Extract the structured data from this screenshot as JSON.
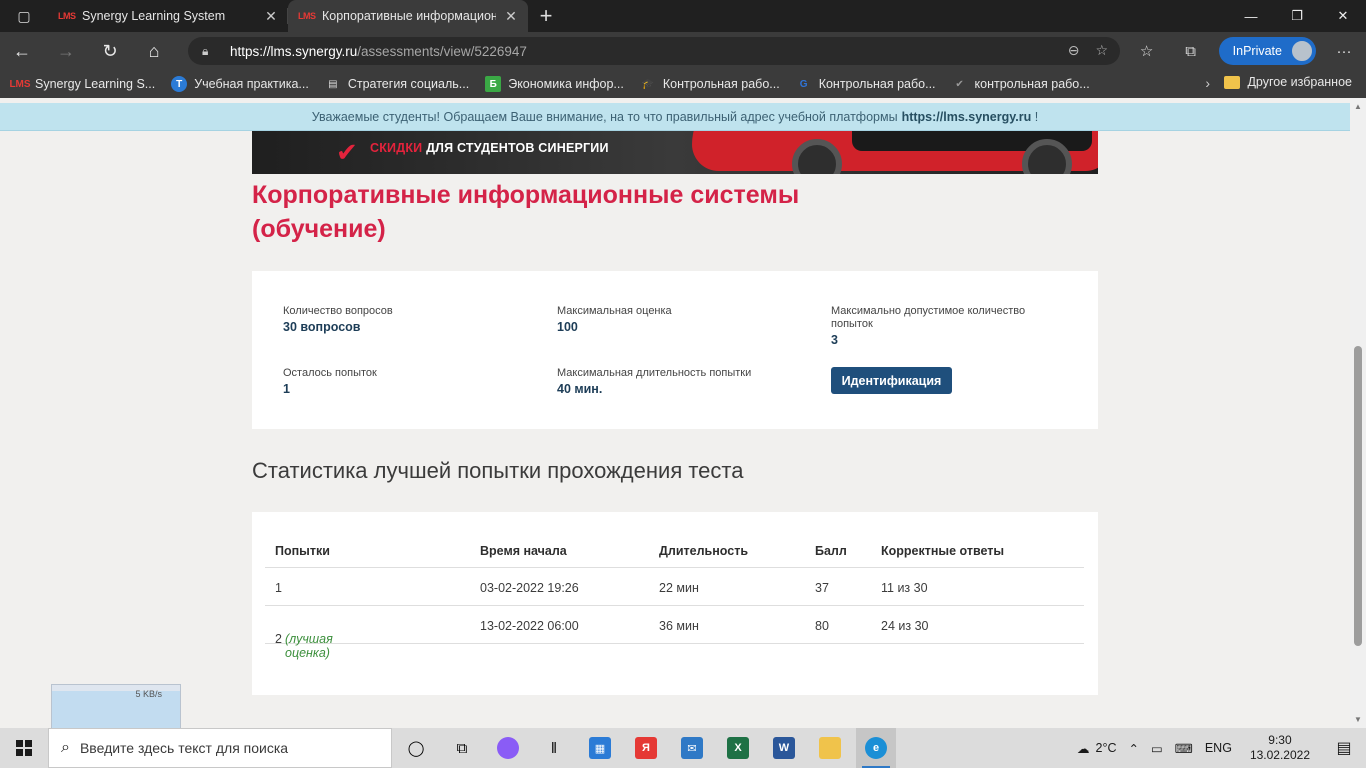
{
  "browser": {
    "tabs": [
      {
        "title": "Synergy Learning System",
        "favicon": "LMS",
        "active": false
      },
      {
        "title": "Корпоративные информацион",
        "favicon": "LMS",
        "active": true
      }
    ],
    "url_host": "https://lms.synergy.ru",
    "url_path": "/assessments/view/5226947",
    "inprivate_label": "InPrivate",
    "bookmarks": [
      {
        "label": "Synergy Learning S...",
        "icon": "LMS",
        "color": "#e53935"
      },
      {
        "label": "Учебная практика...",
        "icon": "Т",
        "color": "#2b7bd6"
      },
      {
        "label": "Стратегия социаль...",
        "icon": "▤",
        "color": "#dddddd"
      },
      {
        "label": "Экономика инфор...",
        "icon": "Б",
        "color": "#3aa845"
      },
      {
        "label": "Контрольная рабо...",
        "icon": "🎓",
        "color": "#ffffff"
      },
      {
        "label": "Контрольная рабо...",
        "icon": "G",
        "color": "#2f74d8"
      },
      {
        "label": "контрольная рабо...",
        "icon": "✔",
        "color": "#999999"
      }
    ],
    "other_favorites": "Другое избранное"
  },
  "notice": {
    "text": "Уважаемые студенты! Обращаем Ваше внимание, на то что правильный адрес учебной платформы",
    "link": "https://lms.synergy.ru",
    "suffix": "!"
  },
  "banner": {
    "text_red": "СКИДКИ",
    "text_white": "ДЛЯ СТУДЕНТОВ СИНЕРГИИ"
  },
  "page": {
    "title": "Корпоративные информационные системы (обучение)",
    "fields": {
      "questions_label": "Количество вопросов",
      "questions_value": "30 вопросов",
      "max_score_label": "Максимальная оценка",
      "max_score_value": "100",
      "max_attempts_label": "Максимально допустимое количество попыток",
      "max_attempts_value": "3",
      "attempts_left_label": "Осталось попыток",
      "attempts_left_value": "1",
      "max_duration_label": "Максимальная длительность попытки",
      "max_duration_value": "40 мин."
    },
    "identify_button": "Идентификация",
    "stats_title": "Статистика лучшей попытки прохождения теста",
    "table": {
      "headers": [
        "Попытки",
        "Время начала",
        "Длительность",
        "Балл",
        "Корректные ответы"
      ],
      "rows": [
        {
          "attempt": "1",
          "note": "",
          "start": "03-02-2022 19:26",
          "duration": "22 мин",
          "score": "37",
          "correct": "11 из 30"
        },
        {
          "attempt": "2",
          "note": "(лучшая оценка)",
          "start": "13-02-2022 06:00",
          "duration": "36 мин",
          "score": "80",
          "correct": "24 из 30"
        }
      ]
    }
  },
  "network_widget": {
    "speed": "5 KB/s"
  },
  "taskbar": {
    "search_placeholder": "Введите здесь текст для поиска",
    "weather": "2°C",
    "lang": "ENG",
    "time": "9:30",
    "date": "13.02.2022"
  }
}
